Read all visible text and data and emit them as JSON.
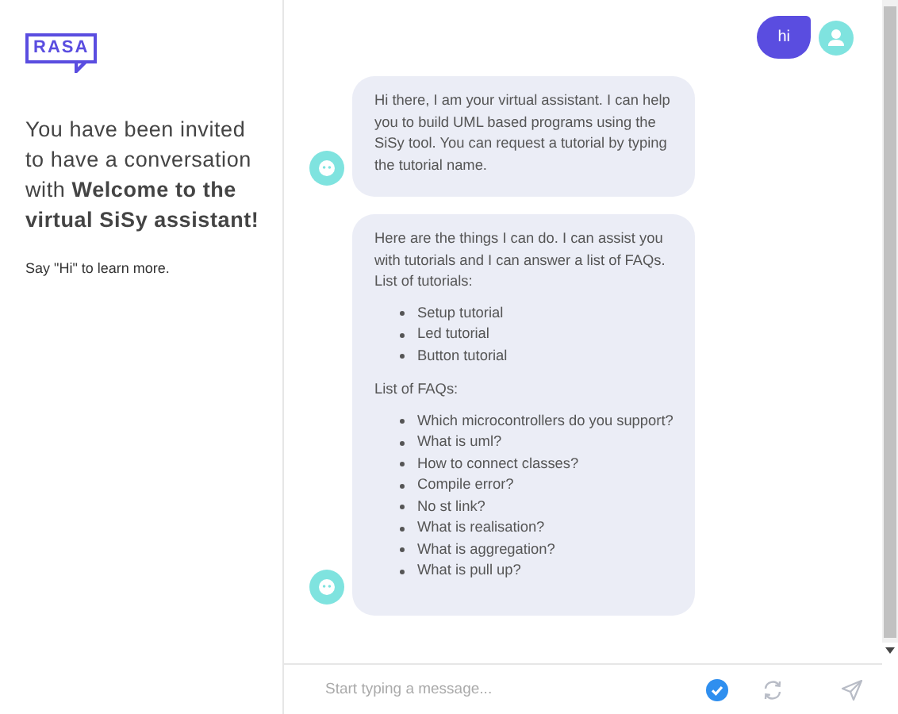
{
  "sidebar": {
    "logo": "RASA",
    "heading": "You have been invited to have a conversation with **Welcome to the virtual SiSy assistant!**",
    "hint": "Say \"Hi\" to learn more."
  },
  "messages": [
    {
      "kind": "user",
      "text": "hi"
    },
    {
      "kind": "bot",
      "blocks": [
        {
          "kind": "paragraph",
          "text": "Hi there, I am your virtual assistant. I can help you to build UML based programs using the SiSy tool. You can request a tutorial by typing the tutorial name."
        }
      ]
    },
    {
      "kind": "bot",
      "blocks": [
        {
          "kind": "paragraph",
          "text": "Here are the things I can do. I can assist you with tutorials and I can answer a list of FAQs."
        },
        {
          "kind": "paragraph",
          "text": "List of tutorials:"
        },
        {
          "kind": "list",
          "items": [
            "Setup tutorial",
            "Led tutorial",
            "Button tutorial"
          ]
        },
        {
          "kind": "paragraph",
          "text": "List of FAQs:"
        },
        {
          "kind": "list",
          "items": [
            "Which microcontrollers do you support?",
            "What is uml?",
            "How to connect classes?",
            "Compile error?",
            "No st link?",
            "What is realisation?",
            "What is aggregation?",
            "What is pull up?"
          ]
        }
      ]
    }
  ],
  "composer": {
    "placeholder": "Start typing a message..."
  }
}
